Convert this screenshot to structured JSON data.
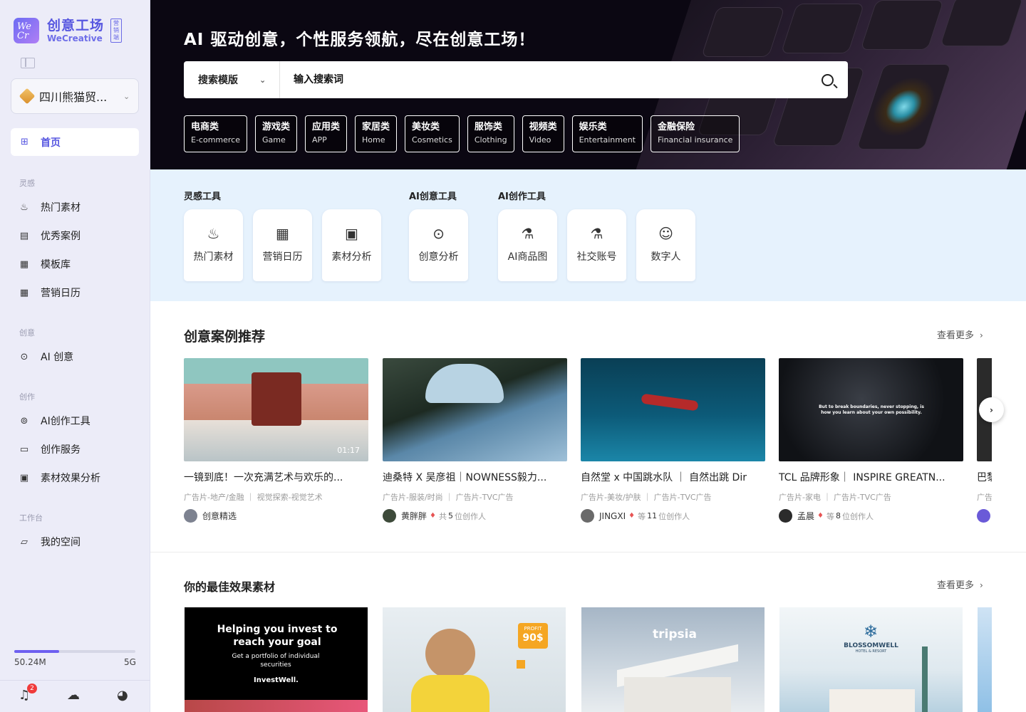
{
  "sidebar": {
    "logo": {
      "mark": "We Cr",
      "cn": "创意工场",
      "en": "WeCreative",
      "tag": "营销端"
    },
    "org_name": "四川熊猫贸...",
    "home_label": "首页",
    "sections": {
      "inspiration": "灵感",
      "creative": "创意",
      "creation": "创作",
      "workbench": "工作台"
    },
    "items": {
      "hot": "热门素材",
      "cases": "优秀案例",
      "templates": "模板库",
      "calendar": "营销日历",
      "ai_creative": "AI 创意",
      "ai_tools": "AI创作工具",
      "services": "创作服务",
      "analysis": "素材效果分析",
      "space": "我的空间"
    },
    "storage": {
      "used": "50.24M",
      "total": "5G",
      "fraction": 0.37
    },
    "notifications": "2"
  },
  "hero": {
    "title": "AI 驱动创意，个性服务领航，尽在创意工场！",
    "search_type": "搜索模版",
    "search_placeholder": "输入搜索词",
    "categories": [
      {
        "cn": "电商类",
        "en": "E-commerce"
      },
      {
        "cn": "游戏类",
        "en": "Game"
      },
      {
        "cn": "应用类",
        "en": "APP"
      },
      {
        "cn": "家居类",
        "en": "Home"
      },
      {
        "cn": "美妆类",
        "en": "Cosmetics"
      },
      {
        "cn": "服饰类",
        "en": "Clothing"
      },
      {
        "cn": "视频类",
        "en": "Video"
      },
      {
        "cn": "娱乐类",
        "en": "Entertainment"
      },
      {
        "cn": "金融保险",
        "en": "Financial insurance"
      }
    ]
  },
  "tools": {
    "groups": {
      "inspiration": "灵感工具",
      "creative": "AI创意工具",
      "creation": "AI创作工具"
    },
    "items": [
      "热门素材",
      "营销日历",
      "素材分析",
      "创意分析",
      "AI商品图",
      "社交账号",
      "数字人"
    ]
  },
  "cases": {
    "title": "创意案例推荐",
    "more": "查看更多",
    "items": [
      {
        "title": "一镜到底！一次充满艺术与欢乐的...",
        "tags": "广告片-地产/金融 ｜ 视觉探索-视觉艺术",
        "author": "创意精选",
        "gem": "",
        "prefix": "",
        "count": "",
        "suffix": "",
        "duration": "01:17"
      },
      {
        "title": "迪桑特 X 吴彦祖｜NOWNESS毅力...",
        "tags": "广告片-服装/时尚 ｜ 广告片-TVC广告",
        "author": "黄胖胖",
        "gem": "♦",
        "prefix": "共",
        "count": "5",
        "suffix": "位创作人",
        "duration": ""
      },
      {
        "title": "自然堂 x 中国跳水队 ｜ 自然出跳 Dir",
        "tags": "广告片-美妆/护肤 ｜ 广告片-TVC广告",
        "author": "JINGXI",
        "gem": "♦",
        "prefix": "等",
        "count": "11",
        "suffix": "位创作人",
        "duration": ""
      },
      {
        "title": "TCL 品牌形象｜ INSPIRE GREATN...",
        "tags": "广告片-家电 ｜ 广告片-TVC广告",
        "author": "孟晨",
        "gem": "♦",
        "prefix": "等",
        "count": "8",
        "suffix": "位创作人",
        "duration": ""
      },
      {
        "title": "巴黎",
        "tags": "广告",
        "author": "",
        "gem": "",
        "prefix": "",
        "count": "",
        "suffix": "",
        "duration": ""
      }
    ],
    "thumb_overlays": {
      "tcl": "But to break boundaries, never stopping, is how you learn about your own possibility."
    }
  },
  "materials": {
    "title": "你的最佳效果素材",
    "more": "查看更多",
    "ad1": {
      "headline": "Helping you invest to reach your goal",
      "sub": "Get a portfolio of individual securities",
      "brand": "InvestWell."
    },
    "ad2": {
      "badge_top": "PROFIT",
      "badge_value": "90$"
    },
    "ad3": {
      "brand": "tripsia"
    },
    "ad4": {
      "brand": "BLOSSOMWELL",
      "sub": "HOTEL & RESORT"
    }
  }
}
